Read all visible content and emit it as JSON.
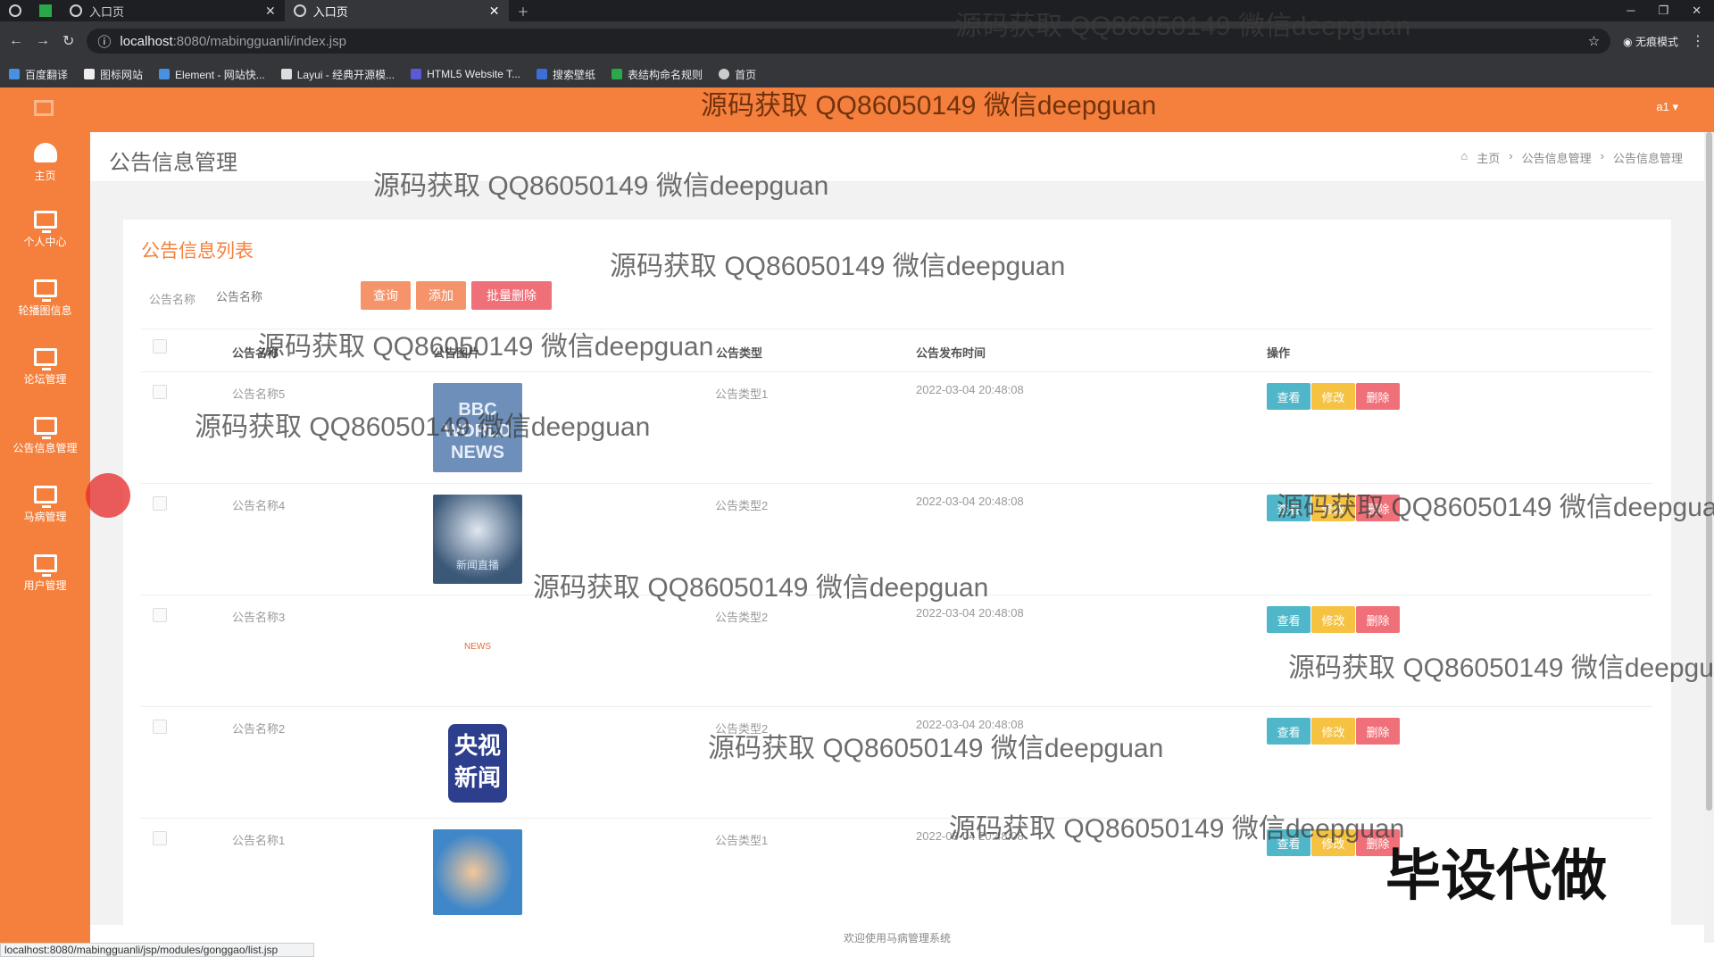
{
  "browser": {
    "tabs": [
      {
        "label": "入口页"
      },
      {
        "label": "入口页"
      }
    ],
    "url_host": "localhost",
    "url_path": ":8080/mabingguanli/index.jsp",
    "profile_label": "无痕模式",
    "bookmarks": [
      "百度翻译",
      "图标网站",
      "Element - 网站快...",
      "Layui - 经典开源模...",
      "HTML5 Website T...",
      "搜索壁纸",
      "表结构命名规则",
      "首页"
    ]
  },
  "topbar": {
    "user": "a1 ▾"
  },
  "sidebar": {
    "items": [
      {
        "label": "主页",
        "icon": "dashboard-icon"
      },
      {
        "label": "个人中心",
        "icon": "monitor-icon"
      },
      {
        "label": "轮播图信息",
        "icon": "monitor-icon"
      },
      {
        "label": "论坛管理",
        "icon": "monitor-icon"
      },
      {
        "label": "公告信息管理",
        "icon": "monitor-icon"
      },
      {
        "label": "马病管理",
        "icon": "monitor-icon"
      },
      {
        "label": "用户管理",
        "icon": "monitor-icon"
      }
    ]
  },
  "page": {
    "title": "公告信息管理",
    "breadcrumb": [
      "主页",
      "公告信息管理",
      "公告信息管理"
    ],
    "list_title": "公告信息列表",
    "search_label": "公告名称",
    "search_placeholder": "公告名称",
    "buttons": {
      "query": "查询",
      "add": "添加",
      "batch_delete": "批量删除"
    },
    "columns": [
      "公告名称",
      "公告图片",
      "公告类型",
      "公告发布时间",
      "操作"
    ],
    "rows": [
      {
        "name": "公告名称5",
        "type": "公告类型1",
        "time": "2022-03-04 20:48:08",
        "img_text": "BBC WORLD NEWS"
      },
      {
        "name": "公告名称4",
        "type": "公告类型2",
        "time": "2022-03-04 20:48:08",
        "img_text": "新闻直播"
      },
      {
        "name": "公告名称3",
        "type": "公告类型2",
        "time": "2022-03-04 20:48:08",
        "img_text": "NEWS"
      },
      {
        "name": "公告名称2",
        "type": "公告类型2",
        "time": "2022-03-04 20:48:08",
        "img_text": "央视新闻"
      },
      {
        "name": "公告名称1",
        "type": "公告类型1",
        "time": "2022-03-04 20:48:08",
        "img_text": ""
      }
    ],
    "row_actions": {
      "view": "查看",
      "edit": "修改",
      "delete": "删除"
    }
  },
  "footer": {
    "text": "欢迎使用马病管理系统"
  },
  "status_url": "localhost:8080/mabingguanli/jsp/modules/gonggao/list.jsp",
  "watermark": "源码获取 QQ86050149 微信deepguan",
  "promo": "毕设代做",
  "colors": {
    "accent": "#f5803d",
    "view": "#4fb7c9",
    "edit": "#f5c242",
    "delete": "#f07079"
  }
}
